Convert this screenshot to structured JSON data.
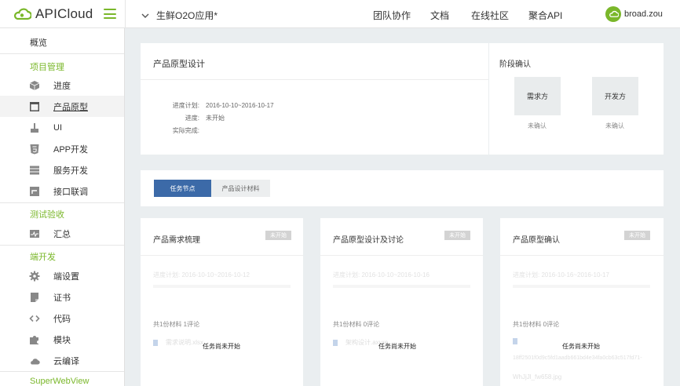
{
  "brand": {
    "name": "APICloud",
    "color": "#7ab72a"
  },
  "header": {
    "project": "生鲜O2O应用*",
    "nav": [
      "团队协作",
      "文档",
      "在线社区",
      "聚合API"
    ],
    "user": "broad.zou"
  },
  "sidebar": {
    "top": "概览",
    "groups": [
      {
        "title": "项目管理",
        "items": [
          {
            "label": "进度",
            "icon": "cube-icon"
          },
          {
            "label": "产品原型",
            "icon": "layout-icon",
            "active": true
          },
          {
            "label": "UI",
            "icon": "brush-icon"
          },
          {
            "label": "APP开发",
            "icon": "html5-icon"
          },
          {
            "label": "服务开发",
            "icon": "server-icon"
          },
          {
            "label": "接口联调",
            "icon": "link-icon"
          }
        ]
      },
      {
        "title": "测试验收",
        "items": [
          {
            "label": "汇总",
            "icon": "pulse-icon"
          }
        ]
      },
      {
        "title": "端开发",
        "items": [
          {
            "label": "端设置",
            "icon": "gear-icon"
          },
          {
            "label": "证书",
            "icon": "certificate-icon"
          },
          {
            "label": "代码",
            "icon": "code-icon"
          },
          {
            "label": "模块",
            "icon": "puzzle-icon"
          },
          {
            "label": "云编译",
            "icon": "cloud-icon"
          }
        ]
      },
      {
        "title": "SuperWebView",
        "items": []
      }
    ]
  },
  "overview": {
    "title": "产品原型设计",
    "plan_key": "进度计划:",
    "plan_value": "2016-10-10~2016-10-17",
    "progress_key": "进度:",
    "progress_value": "未开始",
    "done_key": "实际完成:",
    "done_value": ""
  },
  "stage": {
    "title": "阶段确认",
    "boxes": [
      {
        "label": "需求方",
        "status": "未确认"
      },
      {
        "label": "开发方",
        "status": "未确认"
      }
    ]
  },
  "tabs": {
    "active": "任务节点",
    "inactive": "产品设计材料"
  },
  "tasks": [
    {
      "title": "产品需求梳理",
      "badge": "未开始",
      "plan": "进度计划: 2016-10-10~2016-10-12",
      "count": "共1份材料 1评论",
      "file": "需求说明.xlsx",
      "empty": "任务尚未开始"
    },
    {
      "title": "产品原型设计及讨论",
      "badge": "未开始",
      "plan": "进度计划: 2016-10-10~2016-10-16",
      "count": "共1份材料 0评论",
      "file": "架构设计.axure",
      "empty": "任务尚未开始"
    },
    {
      "title": "产品原型确认",
      "badge": "未开始",
      "plan": "进度计划: 2016-10-16~2016-10-17",
      "count": "共1份材料 0评论",
      "file": "",
      "empty": "任务尚未开始",
      "file_hash": "18ff2501f0d9c5fd1aadb661bd4e34fa0cb63c517fd71-",
      "file_name": "WhJjJl_fw658.jpg"
    }
  ]
}
